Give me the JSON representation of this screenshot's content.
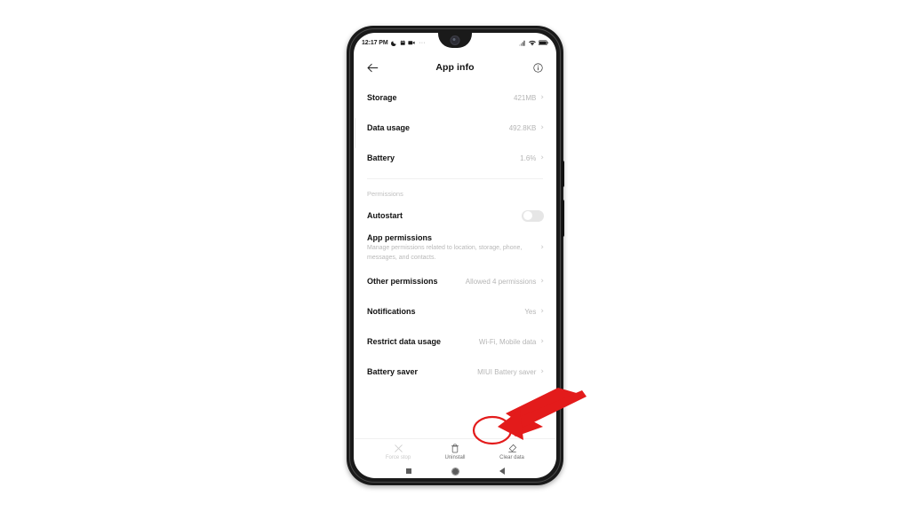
{
  "device": {
    "name": "android-phone",
    "status_bar": {
      "time": "12:17 PM",
      "left_icons": [
        "moon-icon",
        "calendar-icon",
        "video-camera-icon"
      ],
      "overflow": "···",
      "right_icons": [
        "signal-icon",
        "wifi-icon",
        "battery-icon"
      ]
    },
    "nav_bar": {
      "recents_label": "recents",
      "home_label": "home",
      "back_label": "back"
    }
  },
  "app_bar": {
    "back_icon": "arrow-left-icon",
    "title": "App info",
    "info_icon": "info-circle-icon"
  },
  "usage_rows": [
    {
      "label": "Storage",
      "value": "421MB",
      "chevron": "›"
    },
    {
      "label": "Data usage",
      "value": "492.8KB",
      "chevron": "›"
    },
    {
      "label": "Battery",
      "value": "1.6%",
      "chevron": "›"
    }
  ],
  "permissions_section": {
    "header": "Permissions",
    "autostart": {
      "label": "Autostart",
      "toggle_state": "off"
    },
    "app_permissions": {
      "title": "App permissions",
      "subtitle": "Manage permissions related to location, storage, phone, messages, and contacts.",
      "chevron": "›"
    },
    "rows": [
      {
        "label": "Other permissions",
        "value": "Allowed 4 permissions",
        "chevron": "›"
      },
      {
        "label": "Notifications",
        "value": "Yes",
        "chevron": "›"
      },
      {
        "label": "Restrict data usage",
        "value": "Wi-Fi, Mobile data",
        "chevron": "›"
      },
      {
        "label": "Battery saver",
        "value": "MIUI Battery saver",
        "chevron": "›"
      }
    ]
  },
  "action_bar": [
    {
      "label": "Force stop",
      "icon": "close-x-icon",
      "state": "disabled"
    },
    {
      "label": "Uninstall",
      "icon": "trash-icon",
      "state": "enabled"
    },
    {
      "label": "Clear data",
      "icon": "eraser-icon",
      "state": "enabled"
    }
  ],
  "annotation": {
    "highlight_target": "Clear data",
    "shape": "ellipse",
    "arrow": "arrow-pointing-down-left",
    "color": "#e31b1b"
  },
  "colors": {
    "annotation_red": "#e31b1b",
    "frame_black": "#1a1a1a",
    "screen_white": "#ffffff",
    "label_dark": "#111111",
    "value_grey": "#b6b6b6"
  }
}
